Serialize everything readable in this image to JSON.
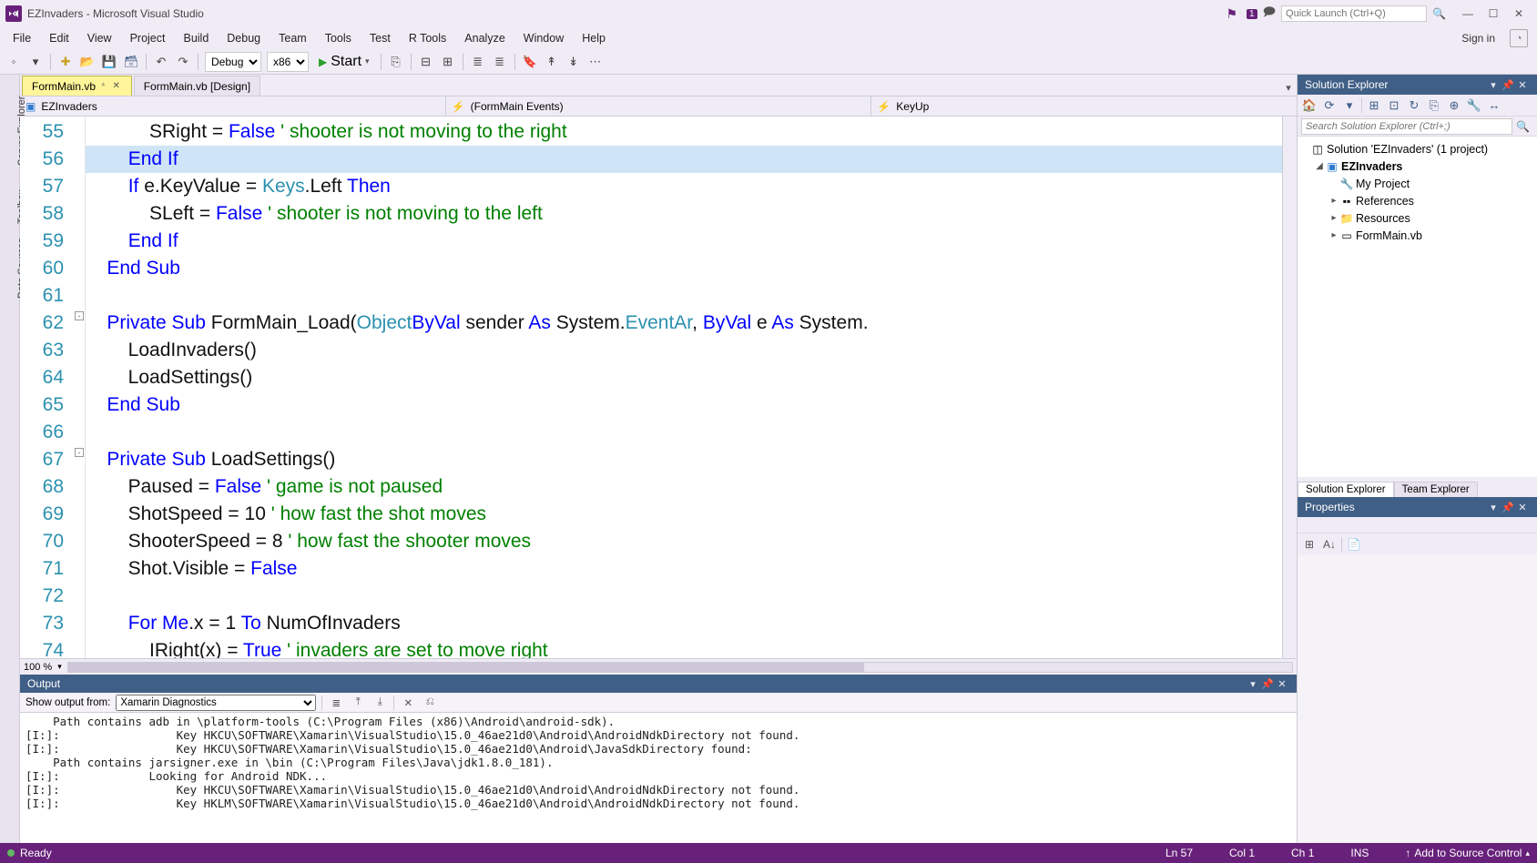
{
  "title": "EZInvaders - Microsoft Visual Studio",
  "quick_launch_placeholder": "Quick Launch (Ctrl+Q)",
  "notif_badge": "1",
  "sign_in": "Sign in",
  "menus": [
    "File",
    "Edit",
    "View",
    "Project",
    "Build",
    "Debug",
    "Team",
    "Tools",
    "Test",
    "R Tools",
    "Analyze",
    "Window",
    "Help"
  ],
  "toolbar": {
    "config": "Debug",
    "platform": "x86",
    "start": "Start"
  },
  "tabs": [
    {
      "label": "FormMain.vb",
      "active": true,
      "dirty": true
    },
    {
      "label": "FormMain.vb [Design]",
      "active": false,
      "dirty": false
    }
  ],
  "nav": {
    "left": "EZInvaders",
    "mid": "(FormMain Events)",
    "right": "KeyUp"
  },
  "rails": [
    "Server Explorer",
    "Toolbox",
    "Data Sources"
  ],
  "zoom": "100 %",
  "code": {
    "first_line": 55,
    "selected_line": 56,
    "lines": [
      {
        "n": 55,
        "t": "            SRight = ",
        "kw": "False",
        "cm": " ' shooter is not moving to the right"
      },
      {
        "n": 56,
        "t": "        ",
        "kw2": "End If"
      },
      {
        "n": 57,
        "t": "        ",
        "kw": "If",
        "t2": " e.KeyValue = ",
        "type": "Keys",
        "t3": ".Left ",
        "kw3": "Then"
      },
      {
        "n": 58,
        "t": "            SLeft = ",
        "kw": "False",
        "cm": " ' shooter is not moving to the left"
      },
      {
        "n": 59,
        "t": "        ",
        "kw2": "End If"
      },
      {
        "n": 60,
        "t": "    ",
        "kw2": "End Sub"
      },
      {
        "n": 61,
        "t": ""
      },
      {
        "n": 62,
        "t": "    ",
        "kw": "Private Sub",
        "t2": " FormMain_Load(",
        "kw4": "ByVal",
        "t3": " sender ",
        "kw5": "As",
        "t4": " System.",
        "type": "Object",
        "t5": ", ",
        "kw6": "ByVal",
        "t6": " e ",
        "kw7": "As",
        "t7": " System.",
        "type2": "EventAr"
      },
      {
        "n": 63,
        "t": "        LoadInvaders()"
      },
      {
        "n": 64,
        "t": "        LoadSettings()"
      },
      {
        "n": 65,
        "t": "    ",
        "kw2": "End Sub"
      },
      {
        "n": 66,
        "t": ""
      },
      {
        "n": 67,
        "t": "    ",
        "kw": "Private Sub",
        "t2": " LoadSettings()"
      },
      {
        "n": 68,
        "t": "        Paused = ",
        "kw": "False",
        "cm": " ' game is not paused"
      },
      {
        "n": 69,
        "t": "        ShotSpeed = 10 ",
        "cm": "' how fast the shot moves"
      },
      {
        "n": 70,
        "t": "        ShooterSpeed = 8 ",
        "cm": "' how fast the shooter moves"
      },
      {
        "n": 71,
        "t": "        Shot.Visible = ",
        "kw": "False"
      },
      {
        "n": 72,
        "t": ""
      },
      {
        "n": 73,
        "t": "        ",
        "kw": "For",
        "t2": " ",
        "kw4": "Me",
        "t3": ".x = 1 ",
        "kw5": "To",
        "t4": " NumOfInvaders"
      },
      {
        "n": 74,
        "t": "            IRight(x) = ",
        "kw": "True",
        "cm": " ' invaders are set to move right"
      }
    ]
  },
  "output": {
    "title": "Output",
    "from_label": "Show output from:",
    "from_value": "Xamarin Diagnostics",
    "text": "    Path contains adb in \\platform-tools (C:\\Program Files (x86)\\Android\\android-sdk).\n[I:]:                 Key HKCU\\SOFTWARE\\Xamarin\\VisualStudio\\15.0_46ae21d0\\Android\\AndroidNdkDirectory not found.\n[I:]:                 Key HKCU\\SOFTWARE\\Xamarin\\VisualStudio\\15.0_46ae21d0\\Android\\JavaSdkDirectory found:\n    Path contains jarsigner.exe in \\bin (C:\\Program Files\\Java\\jdk1.8.0_181).\n[I:]:             Looking for Android NDK...\n[I:]:                 Key HKCU\\SOFTWARE\\Xamarin\\VisualStudio\\15.0_46ae21d0\\Android\\AndroidNdkDirectory not found.\n[I:]:                 Key HKLM\\SOFTWARE\\Xamarin\\VisualStudio\\15.0_46ae21d0\\Android\\AndroidNdkDirectory not found."
  },
  "solution_explorer": {
    "title": "Solution Explorer",
    "search_placeholder": "Search Solution Explorer (Ctrl+;)",
    "tree": {
      "solution": "Solution 'EZInvaders' (1 project)",
      "project": "EZInvaders",
      "children": [
        "My Project",
        "References",
        "Resources",
        "FormMain.vb"
      ]
    },
    "bottom_tabs": [
      "Solution Explorer",
      "Team Explorer"
    ]
  },
  "properties": {
    "title": "Properties"
  },
  "status": {
    "ready": "Ready",
    "ln": "Ln 57",
    "col": "Col 1",
    "ch": "Ch 1",
    "ins": "INS",
    "add": "Add to Source Control"
  }
}
